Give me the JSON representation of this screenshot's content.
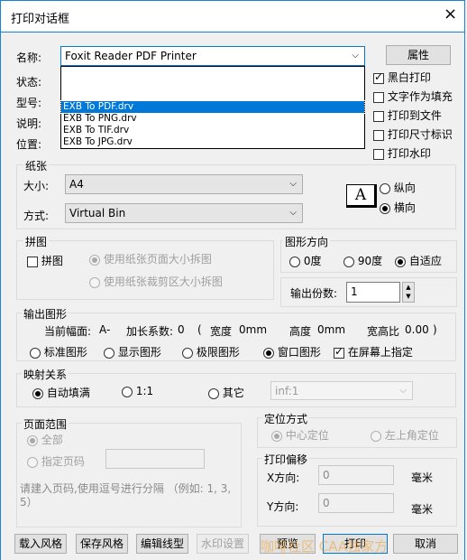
{
  "window": {
    "title": "打印对话框",
    "close_glyph": "×"
  },
  "printer": {
    "name_label": "名称:",
    "selected": "Foxit Reader PDF Printer",
    "properties_button": "属性",
    "status_label": "状态:",
    "type_label": "型号:",
    "desc_label": "说明:",
    "location_label": "位置:",
    "dropdown_items": [
      "EXB To PDF.drv",
      "EXB To PNG.drv",
      "EXB To TIF.drv",
      "EXB To JPG.drv"
    ],
    "dropdown_selected_index": 0
  },
  "options": {
    "bw_print": {
      "label": "黑白打印",
      "checked": true
    },
    "text_fill": {
      "label": "文字作为填充",
      "checked": false
    },
    "print_to_file": {
      "label": "打印到文件",
      "checked": false
    },
    "print_size_mark": {
      "label": "打印尺寸标识",
      "checked": false
    },
    "print_watermark": {
      "label": "打印水印",
      "checked": false
    }
  },
  "paper": {
    "group_title": "纸张",
    "size_label": "大小:",
    "size_value": "A4",
    "mode_label": "方式:",
    "mode_value": "Virtual Bin",
    "orientation_icon": "A",
    "portrait_label": "纵向",
    "landscape_label": "横向",
    "orientation_selected": "landscape"
  },
  "tile": {
    "group_title": "拼图",
    "tile_label": "拼图",
    "tile_checked": false,
    "opt1": "使用纸张页面大小拆图",
    "opt2": "使用纸张裁剪区大小拆图",
    "selected": "opt1"
  },
  "direction": {
    "group_title": "图形方向",
    "opt_0": "0度",
    "opt_90": "90度",
    "opt_auto": "自适应",
    "selected": "auto",
    "copies_label": "输出份数:",
    "copies_value": "1"
  },
  "output": {
    "group_title": "输出图形",
    "current_label": "当前幅面:",
    "current_value": "A-",
    "factor_label": "加长系数:",
    "factor_value": "0",
    "paren_open": "(",
    "width_label": "宽度",
    "width_value": "0mm",
    "height_label": "高度",
    "height_value": "0mm",
    "ratio_label": "宽高比",
    "ratio_value": "0.00",
    "paren_close": ")",
    "opt_standard": "标准图形",
    "opt_display": "显示图形",
    "opt_extreme": "极限图形",
    "opt_window": "窗口图形",
    "selected": "window",
    "on_screen_label": "在屏幕上指定",
    "on_screen_checked": true
  },
  "mapping": {
    "group_title": "映射关系",
    "opt_auto": "自动填满",
    "opt_11": "1:1",
    "opt_other": "其它",
    "selected": "auto",
    "other_value": "inf:1"
  },
  "page_range": {
    "group_title": "页面范围",
    "opt_all": "全部",
    "opt_pages": "指定页码",
    "selected": "all",
    "hint": "请建入页码,使用逗号进行分隔 （例如: 1, 3, 5）"
  },
  "position": {
    "group_title": "定位方式",
    "opt_center": "中心定位",
    "opt_topleft": "左上角定位",
    "selected": "center"
  },
  "offset": {
    "group_title": "打印偏移",
    "x_label": "X方向:",
    "x_value": "0",
    "x_unit": "毫米",
    "y_label": "Y方向:",
    "y_value": "0",
    "y_unit": "毫米"
  },
  "footer": {
    "load_style": "载入风格",
    "save_style": "保存风格",
    "edit_linetype": "编辑线型",
    "watermark_settings": "水印设置",
    "preview": "预览",
    "print": "打印",
    "cancel": "取消"
  },
  "watermark_text": "咖啡社区 CAA独家方",
  "colors": {
    "accent": "#0078d7",
    "border": "#1883d7",
    "watermark": "#f0a030"
  }
}
